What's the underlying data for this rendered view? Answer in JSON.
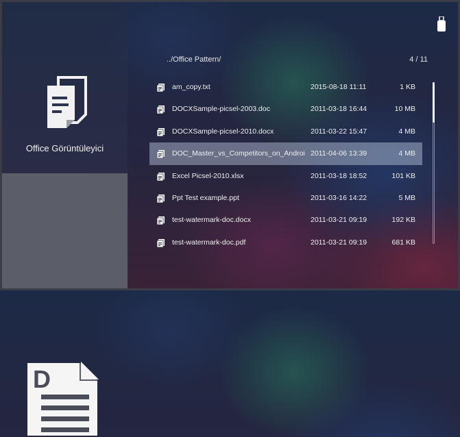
{
  "sidebar": {
    "app_title": "Office Görüntüleyici",
    "app_icon": "document-stack-icon",
    "preview_icon": "doc-file-icon",
    "preview_letter": "D"
  },
  "header": {
    "path": "../Office Pattern/",
    "page_indicator": "4 / 11",
    "storage_icon": "usb-drive-icon"
  },
  "files": [
    {
      "name": "am_copy.txt",
      "date": "2015-08-18 11:11",
      "size": "1 KB",
      "selected": false
    },
    {
      "name": "DOCXSample-picsel-2003.doc",
      "date": "2011-03-18 16:44",
      "size": "10 MB",
      "selected": false
    },
    {
      "name": "DOCXSample-picsel-2010.docx",
      "date": "2011-03-22 15:47",
      "size": "4 MB",
      "selected": false
    },
    {
      "name": "DOC_Master_vs_Competitors_on_Androi",
      "date": "2011-04-06 13:39",
      "size": "4 MB",
      "selected": true
    },
    {
      "name": "Excel Picsel-2010.xlsx",
      "date": "2011-03-18 18:52",
      "size": "101 KB",
      "selected": false
    },
    {
      "name": "Ppt Test example.ppt",
      "date": "2011-03-16 14:22",
      "size": "5 MB",
      "selected": false
    },
    {
      "name": "test-watermark-doc.docx",
      "date": "2011-03-21 09:19",
      "size": "192 KB",
      "selected": false
    },
    {
      "name": "test-watermark-doc.pdf",
      "date": "2011-03-21 09:19",
      "size": "681 KB",
      "selected": false
    }
  ],
  "file_icon": "document-icon",
  "scrollbar": {
    "position": 0.0,
    "visible_fraction": 0.25
  },
  "colors": {
    "selection": "#bccde1",
    "sidebar_bottom": "#5b5e69"
  }
}
